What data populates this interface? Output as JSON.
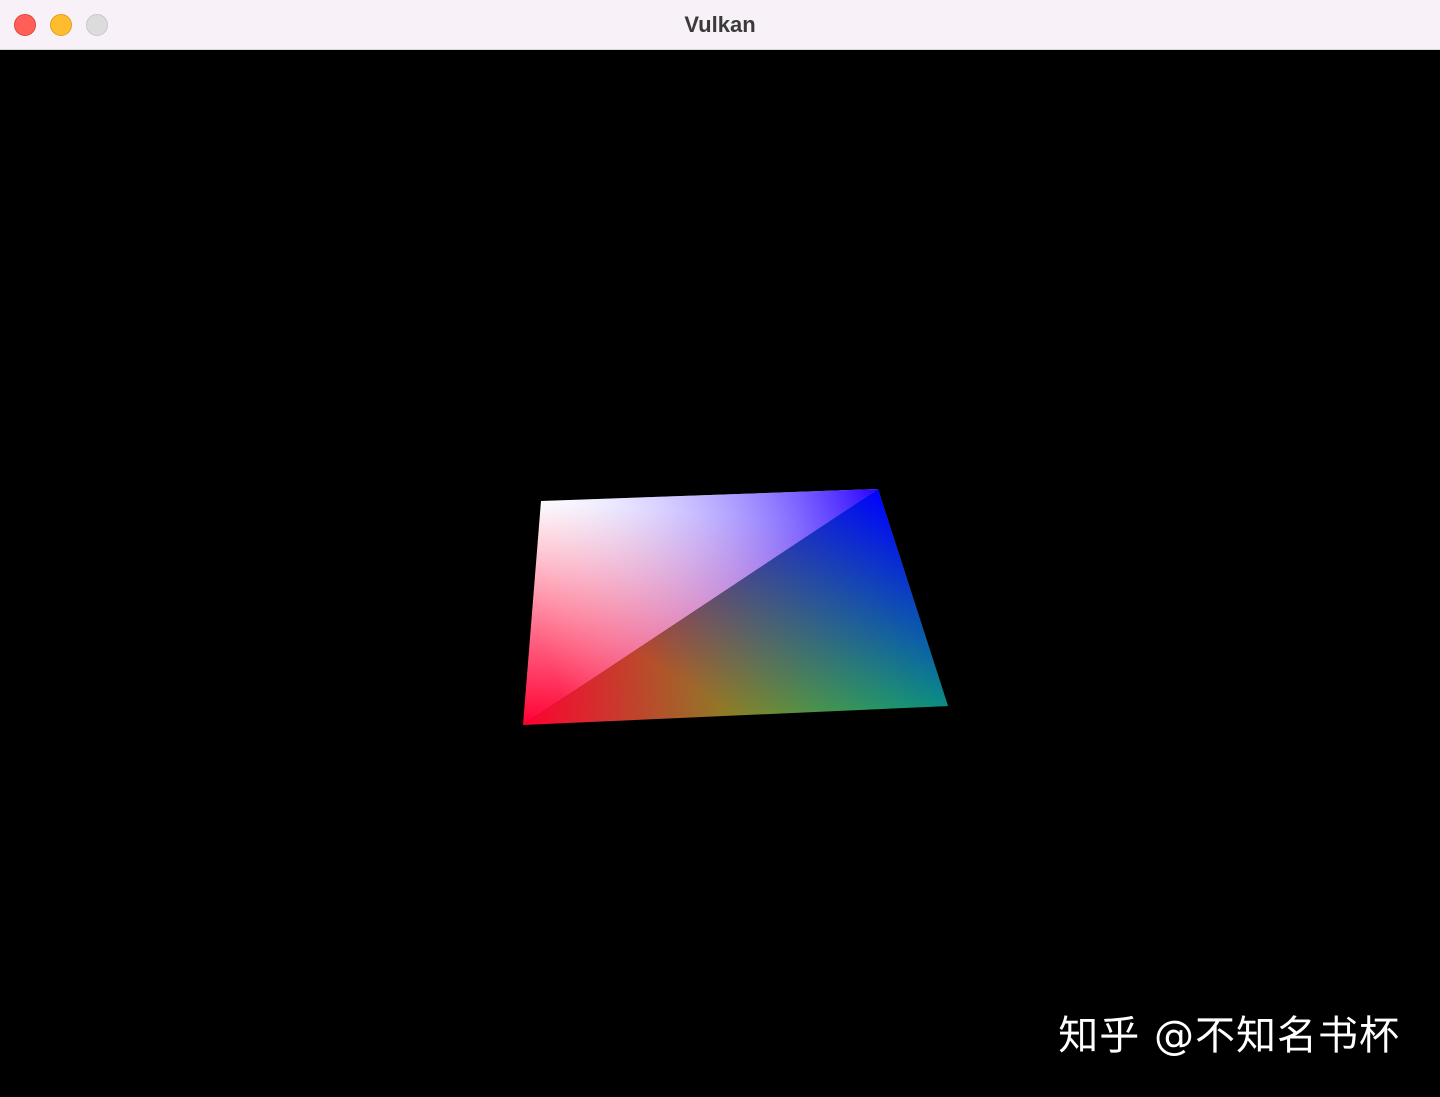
{
  "window": {
    "title": "Vulkan",
    "controls": {
      "close_color": "#ff5f57",
      "minimize_color": "#febc2e",
      "zoom_color": "#dcdcdc"
    }
  },
  "viewport": {
    "background": "#000000",
    "rendered_object": {
      "type": "textured quad (two triangles, per-vertex colors)",
      "vertex_colors": {
        "top_left": "#ffffff",
        "top_right": "#0000ff",
        "bottom_right": "#00ff00",
        "bottom_left": "#ff0000"
      }
    }
  },
  "watermark": {
    "text": "知乎 @不知名书杯"
  }
}
